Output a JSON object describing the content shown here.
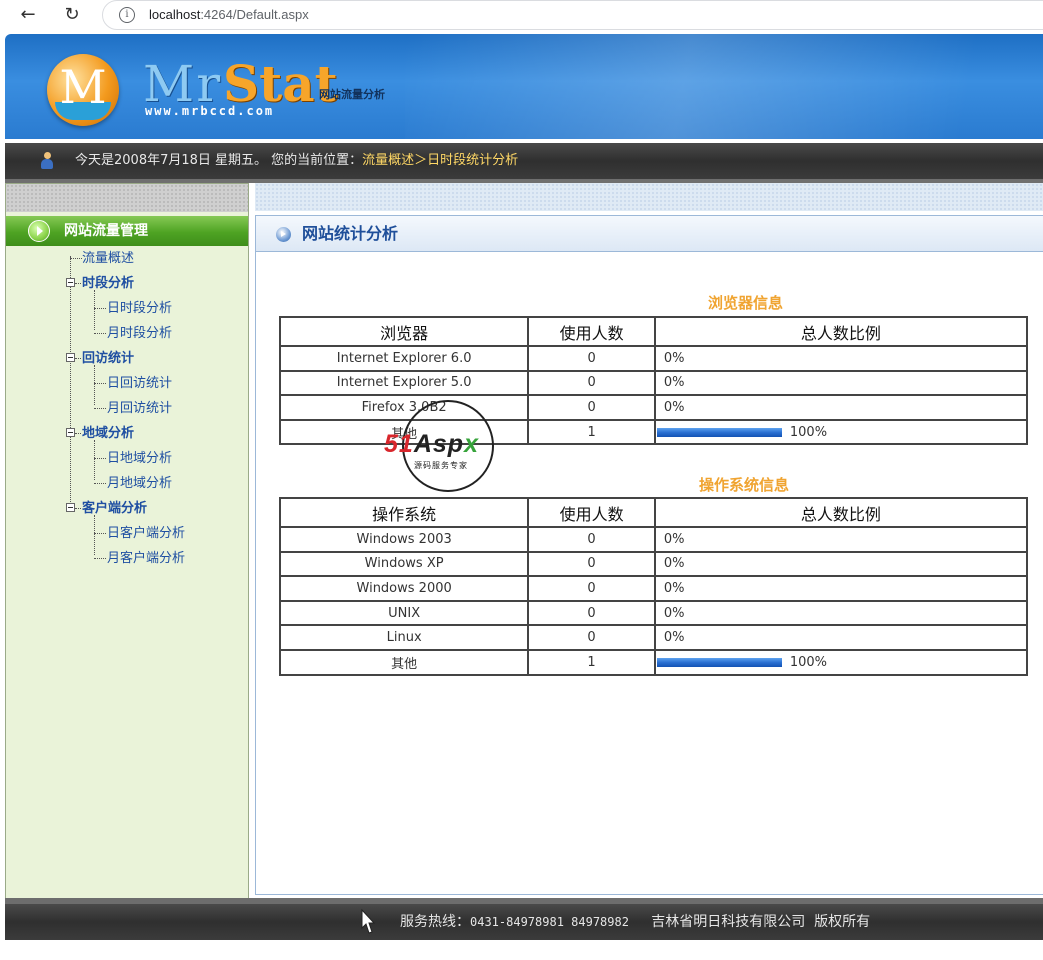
{
  "browser": {
    "url_host": "localhost",
    "url_rest": ":4264/Default.aspx"
  },
  "banner": {
    "logo_letter": "M",
    "logo_mr": "Mr",
    "logo_stat": "Stat",
    "logo_subtitle": "网站流量分析",
    "logo_url": "www.mrbccd.com"
  },
  "status_bar": {
    "prefix": "今天是2008年7月18日 星期五。 您的当前位置：",
    "location": "流量概述＞日时段统计分析"
  },
  "sidebar": {
    "header": "网站流量管理",
    "overview": "流量概述",
    "groups": [
      {
        "label": "时段分析",
        "items": [
          "日时段分析",
          "月时段分析"
        ]
      },
      {
        "label": "回访统计",
        "items": [
          "日回访统计",
          "月回访统计"
        ]
      },
      {
        "label": "地域分析",
        "items": [
          "日地域分析",
          "月地域分析"
        ]
      },
      {
        "label": "客户端分析",
        "items": [
          "日客户端分析",
          "月客户端分析"
        ]
      }
    ]
  },
  "content": {
    "title": "网站统计分析",
    "browser_section": {
      "title": "浏览器信息",
      "headers": [
        "浏览器",
        "使用人数",
        "总人数比例"
      ],
      "rows": [
        {
          "name": "Internet Explorer 6.0",
          "count": "0",
          "pct": "0%",
          "fraction": 0
        },
        {
          "name": "Internet Explorer 5.0",
          "count": "0",
          "pct": "0%",
          "fraction": 0
        },
        {
          "name": "Firefox 3.0B2",
          "count": "0",
          "pct": "0%",
          "fraction": 0
        },
        {
          "name": "其他",
          "count": "1",
          "pct": "100%",
          "fraction": 1
        }
      ]
    },
    "os_section": {
      "title": "操作系统信息",
      "headers": [
        "操作系统",
        "使用人数",
        "总人数比例"
      ],
      "rows": [
        {
          "name": "Windows 2003",
          "count": "0",
          "pct": "0%",
          "fraction": 0
        },
        {
          "name": "Windows XP",
          "count": "0",
          "pct": "0%",
          "fraction": 0
        },
        {
          "name": "Windows 2000",
          "count": "0",
          "pct": "0%",
          "fraction": 0
        },
        {
          "name": "UNIX",
          "count": "0",
          "pct": "0%",
          "fraction": 0
        },
        {
          "name": "Linux",
          "count": "0",
          "pct": "0%",
          "fraction": 0
        },
        {
          "name": "其他",
          "count": "1",
          "pct": "100%",
          "fraction": 1
        }
      ]
    }
  },
  "watermark": {
    "brand_51": "51",
    "brand_a": "A",
    "brand_sp": "sp",
    "brand_x": "x",
    "tagline": "源码服务专家"
  },
  "footer": {
    "hotline_label": "服务热线：",
    "hotline_numbers": "0431-84978981  84978982",
    "company": "吉林省明日科技有限公司",
    "rights": "版权所有"
  },
  "colors": {
    "accent_orange": "#f0a431",
    "link_blue": "#1f4fa2",
    "bar_blue": "#2a70d2",
    "sidebar_green": "#4ea323"
  }
}
